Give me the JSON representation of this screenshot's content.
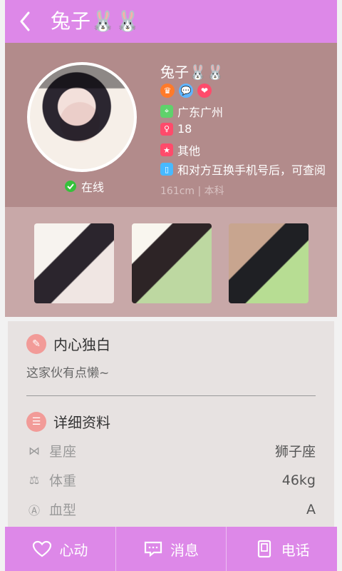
{
  "header": {
    "title": "兔子🐰🐰"
  },
  "profile": {
    "online": "在线",
    "name": "兔子🐰🐰",
    "location": "广东广州",
    "age": "18",
    "other": "其他",
    "phone_note": "和对方互换手机号后，可查阅",
    "height_edu": "161cm | 本科"
  },
  "details": {
    "inner_title": "内心独白",
    "inner_text": "这家伙有点懒~",
    "detail_title": "详细资料",
    "rows": [
      {
        "label": "星座",
        "value": "狮子座"
      },
      {
        "label": "体重",
        "value": "46kg"
      },
      {
        "label": "血型",
        "value": "A"
      }
    ]
  },
  "bottom_bar": {
    "heart": "心动",
    "message": "消息",
    "phone": "电话"
  },
  "colors": {
    "accent": "#dd88e8",
    "profile_bg": "#b28b8b",
    "gallery_bg": "#c8a8a8",
    "details_bg": "#e7e2e1",
    "online": "#36c13b"
  }
}
